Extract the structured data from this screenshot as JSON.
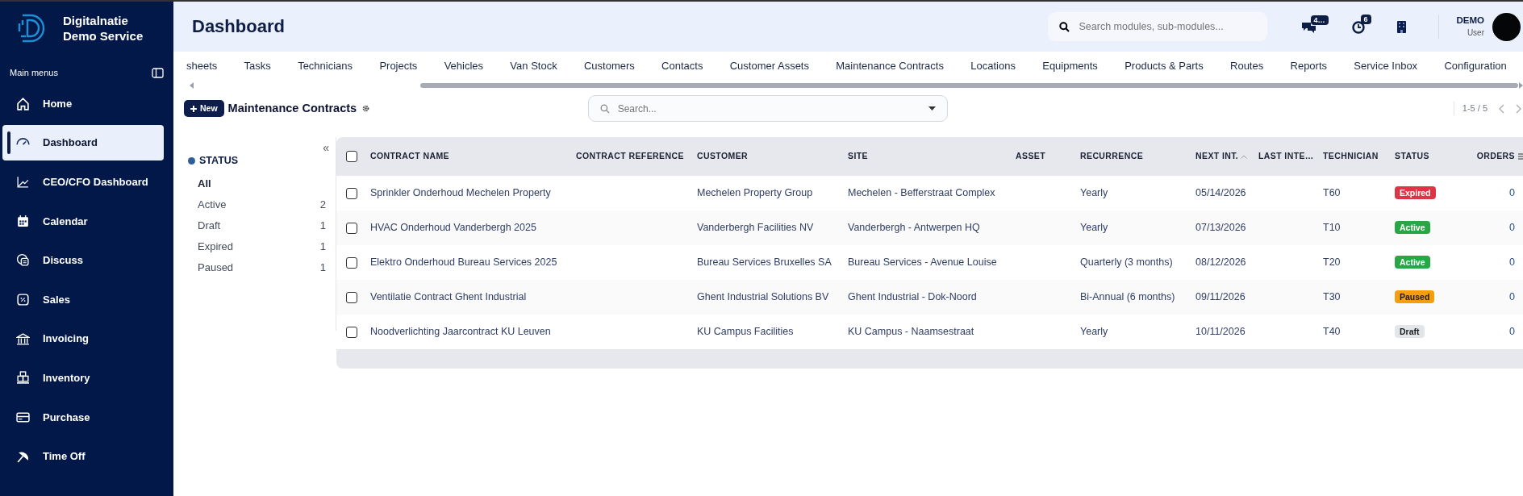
{
  "brand": {
    "title_line1": "Digitalnatie",
    "title_line2": "Demo Service"
  },
  "sidebar": {
    "heading": "Main menus",
    "items": [
      {
        "label": "Home",
        "selected": false
      },
      {
        "label": "Dashboard",
        "selected": true
      },
      {
        "label": "CEO/CFO Dashboard",
        "selected": false
      },
      {
        "label": "Calendar",
        "selected": false
      },
      {
        "label": "Discuss",
        "selected": false
      },
      {
        "label": "Sales",
        "selected": false
      },
      {
        "label": "Invoicing",
        "selected": false
      },
      {
        "label": "Inventory",
        "selected": false
      },
      {
        "label": "Purchase",
        "selected": false
      },
      {
        "label": "Time Off",
        "selected": false
      }
    ]
  },
  "header": {
    "title": "Dashboard",
    "search_placeholder": "Search modules, sub-modules...",
    "messages_badge": "4…",
    "activities_badge": "6",
    "user_name": "DEMO",
    "user_role": "User"
  },
  "tabs": [
    "sheets",
    "Tasks",
    "Technicians",
    "Projects",
    "Vehicles",
    "Van Stock",
    "Customers",
    "Contacts",
    "Customer Assets",
    "Maintenance Contracts",
    "Locations",
    "Equipments",
    "Products & Parts",
    "Routes",
    "Reports",
    "Service Inbox",
    "Configuration"
  ],
  "toolbar": {
    "new_button": "New",
    "title": "Maintenance Contracts",
    "search_placeholder": "Search...",
    "pager": "1-5 / 5"
  },
  "filter": {
    "collapse_glyph": "«",
    "heading": "STATUS",
    "items": [
      {
        "label": "All",
        "selected": true
      },
      {
        "label": "Active",
        "count": "2",
        "selected": false
      },
      {
        "label": "Draft",
        "count": "1",
        "selected": false
      },
      {
        "label": "Expired",
        "count": "1",
        "selected": false
      },
      {
        "label": "Paused",
        "count": "1",
        "selected": false
      }
    ]
  },
  "table": {
    "select_all_checked": false,
    "columns": [
      {
        "label": "CONTRACT NAME",
        "sorted": false
      },
      {
        "label": "CONTRACT REFERENCE",
        "sorted": false
      },
      {
        "label": "CUSTOMER",
        "sorted": false
      },
      {
        "label": "SITE",
        "sorted": false
      },
      {
        "label": "ASSET",
        "sorted": false
      },
      {
        "label": "RECURRENCE",
        "sorted": false
      },
      {
        "label": "NEXT INT.",
        "sorted": true
      },
      {
        "label": "LAST INTE…",
        "sorted": false
      },
      {
        "label": "TECHNICIAN",
        "sorted": false
      },
      {
        "label": "STATUS",
        "sorted": false
      },
      {
        "label": "ORDERS",
        "sorted": false
      }
    ],
    "rows": [
      {
        "checked": false,
        "contract_name": "Sprinkler Onderhoud Mechelen Property",
        "customer": "Mechelen Property Group",
        "site": "Mechelen - Befferstraat Complex",
        "recurrence": "Yearly",
        "next_intervention": "05/14/2026",
        "technician": "T60",
        "status": {
          "label": "Expired",
          "kind": "expired"
        },
        "orders": "0"
      },
      {
        "checked": false,
        "contract_name": "HVAC Onderhoud Vanderbergh 2025",
        "customer": "Vanderbergh Facilities NV",
        "site": "Vanderbergh - Antwerpen HQ",
        "recurrence": "Yearly",
        "next_intervention": "07/13/2026",
        "technician": "T10",
        "status": {
          "label": "Active",
          "kind": "active"
        },
        "orders": "0"
      },
      {
        "checked": false,
        "contract_name": "Elektro Onderhoud Bureau Services 2025",
        "customer": "Bureau Services Bruxelles SA",
        "site": "Bureau Services - Avenue Louise",
        "recurrence": "Quarterly (3 months)",
        "next_intervention": "08/12/2026",
        "technician": "T20",
        "status": {
          "label": "Active",
          "kind": "active"
        },
        "orders": "0"
      },
      {
        "checked": false,
        "contract_name": "Ventilatie Contract Ghent Industrial",
        "customer": "Ghent Industrial Solutions BV",
        "site": "Ghent Industrial - Dok-Noord",
        "recurrence": "Bi-Annual (6 months)",
        "next_intervention": "09/11/2026",
        "technician": "T30",
        "status": {
          "label": "Paused",
          "kind": "paused"
        },
        "orders": "0"
      },
      {
        "checked": false,
        "contract_name": "Noodverlichting Jaarcontract KU Leuven",
        "customer": "KU Campus Facilities",
        "site": "KU Campus - Naamsestraat",
        "recurrence": "Yearly",
        "next_intervention": "10/11/2026",
        "technician": "T40",
        "status": {
          "label": "Draft",
          "kind": "draft"
        },
        "orders": "0"
      }
    ]
  }
}
